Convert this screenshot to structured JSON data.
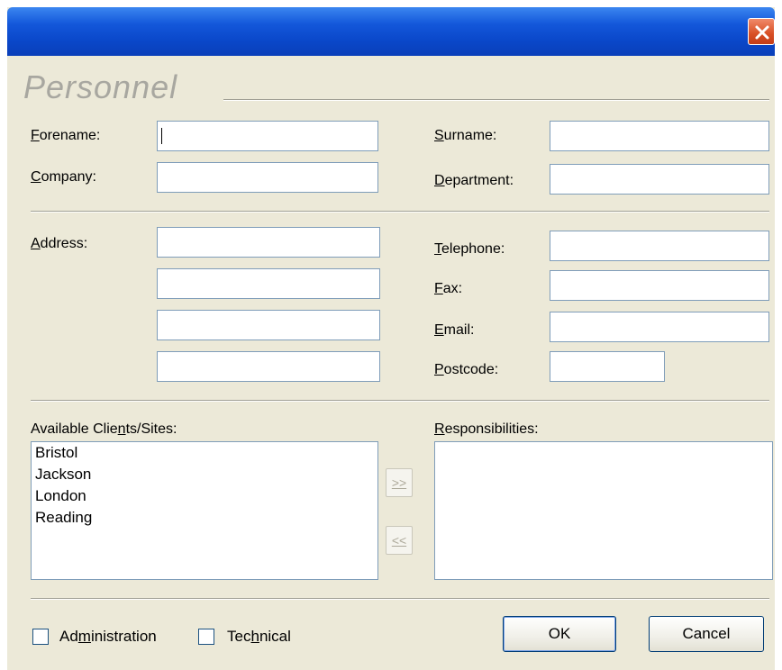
{
  "window": {
    "title": "",
    "close_icon": "close-x-icon"
  },
  "section_title": "Personnel",
  "fields": {
    "forename": {
      "label_u": "F",
      "label_rest": "orename:",
      "value": ""
    },
    "company": {
      "label_u": "C",
      "label_rest": "ompany:",
      "value": ""
    },
    "surname": {
      "label_u": "S",
      "label_rest": "urname:",
      "value": ""
    },
    "department": {
      "label_u": "D",
      "label_rest": "epartment:",
      "value": ""
    },
    "address": {
      "label_u": "A",
      "label_rest": "ddress:",
      "lines": [
        "",
        "",
        "",
        ""
      ]
    },
    "telephone": {
      "label_u": "T",
      "label_rest": "elephone:",
      "value": ""
    },
    "fax": {
      "label_u": "F",
      "label_rest": "ax:",
      "value": ""
    },
    "email": {
      "label_u": "E",
      "label_rest": "mail:",
      "value": ""
    },
    "postcode": {
      "label_u": "P",
      "label_rest": "ostcode:",
      "value": ""
    }
  },
  "available": {
    "label_pre": "Available Clie",
    "label_u": "n",
    "label_post": "ts/Sites:",
    "items": [
      "Bristol",
      "Jackson",
      "London",
      "Reading"
    ]
  },
  "responsibilities": {
    "label_u": "R",
    "label_rest": "esponsibilities:",
    "items": []
  },
  "move_buttons": {
    "add": ">>",
    "remove": "<<"
  },
  "checkboxes": {
    "administration": {
      "pre": "Ad",
      "u": "m",
      "post": "inistration",
      "checked": false
    },
    "technical": {
      "pre": "Tec",
      "u": "h",
      "post": "nical",
      "checked": false
    }
  },
  "buttons": {
    "ok": "OK",
    "cancel": "Cancel"
  }
}
